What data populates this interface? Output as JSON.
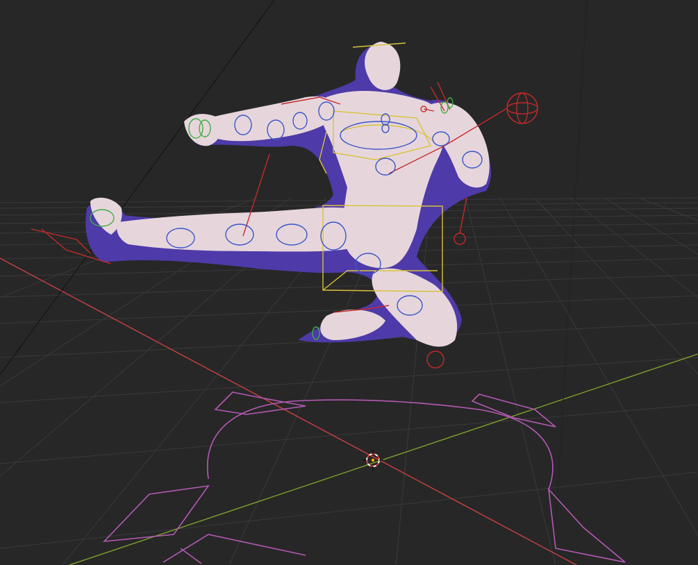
{
  "viewport": {
    "background": "#272727",
    "grid_color": "#3a3a3a",
    "x_axis_color": "#c0413f",
    "y_axis_color": "#7a9a2b"
  },
  "rig": {
    "root_control_color": "#b45ab4",
    "fk_control_color": "#3a55c9",
    "ik_control_color": "#c42a2a",
    "torso_control_color": "#d8c23a",
    "finger_control_color": "#3fae3f",
    "character_body_color": "#e6d6dc",
    "character_shadow_color": "#4e3aa8"
  },
  "cursor_3d": {
    "icon": "3d-cursor-icon",
    "color_a": "#d63b3b",
    "color_b": "#ffffff"
  }
}
